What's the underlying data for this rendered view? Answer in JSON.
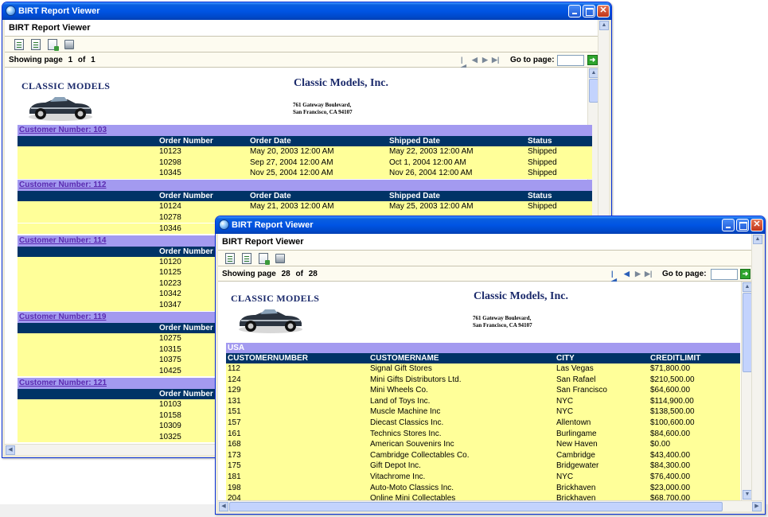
{
  "back_window": {
    "title": "BIRT Report Viewer",
    "header": "BIRT Report Viewer",
    "nav": {
      "showing": "Showing page",
      "page": "1",
      "of": "of",
      "total": "1",
      "goto_label": "Go to page:"
    },
    "company_name": "Classic Models, Inc.",
    "logo_text": "CLASSIC MODELS",
    "address_line1": "761 Gateway Boulevard,",
    "address_line2": "San Francisco, CA 94107",
    "columns": [
      "Order Number",
      "Order Date",
      "Shipped Date",
      "Status"
    ],
    "groups": [
      {
        "label": "Customer Number: 103",
        "rows": [
          [
            "10123",
            "May 20, 2003 12:00 AM",
            "May 22, 2003 12:00 AM",
            "Shipped"
          ],
          [
            "10298",
            "Sep 27, 2004 12:00 AM",
            "Oct 1, 2004 12:00 AM",
            "Shipped"
          ],
          [
            "10345",
            "Nov 25, 2004 12:00 AM",
            "Nov 26, 2004 12:00 AM",
            "Shipped"
          ]
        ]
      },
      {
        "label": "Customer Number: 112",
        "rows": [
          [
            "10124",
            "May 21, 2003 12:00 AM",
            "May 25, 2003 12:00 AM",
            "Shipped"
          ],
          [
            "10278",
            "",
            "",
            ""
          ],
          [
            "10346",
            "",
            "",
            ""
          ]
        ]
      },
      {
        "label": "Customer Number: 114",
        "rows": [
          [
            "10120",
            "",
            "",
            ""
          ],
          [
            "10125",
            "",
            "",
            ""
          ],
          [
            "10223",
            "",
            "",
            ""
          ],
          [
            "10342",
            "",
            "",
            ""
          ],
          [
            "10347",
            "",
            "",
            ""
          ]
        ]
      },
      {
        "label": "Customer Number: 119",
        "rows": [
          [
            "10275",
            "",
            "",
            ""
          ],
          [
            "10315",
            "",
            "",
            ""
          ],
          [
            "10375",
            "",
            "",
            ""
          ],
          [
            "10425",
            "",
            "",
            ""
          ]
        ]
      },
      {
        "label": "Customer Number: 121",
        "rows": [
          [
            "10103",
            "",
            "",
            ""
          ],
          [
            "10158",
            "",
            "",
            ""
          ],
          [
            "10309",
            "",
            "",
            ""
          ],
          [
            "10325",
            "",
            "",
            ""
          ]
        ]
      }
    ]
  },
  "front_window": {
    "title": "BIRT Report Viewer",
    "header": "BIRT Report Viewer",
    "nav": {
      "showing": "Showing page",
      "page": "28",
      "of": "of",
      "total": "28",
      "goto_label": "Go to page:"
    },
    "company_name": "Classic Models, Inc.",
    "logo_text": "CLASSIC MODELS",
    "address_line1": "761 Gateway Boulevard,",
    "address_line2": "San Francisco, CA 94107",
    "country": "USA",
    "columns": [
      "CUSTOMERNUMBER",
      "CUSTOMERNAME",
      "CITY",
      "CREDITLIMIT"
    ],
    "rows": [
      [
        "112",
        "Signal Gift Stores",
        "Las Vegas",
        "$71,800.00"
      ],
      [
        "124",
        "Mini Gifts Distributors Ltd.",
        "San Rafael",
        "$210,500.00"
      ],
      [
        "129",
        "Mini Wheels Co.",
        "San Francisco",
        "$64,600.00"
      ],
      [
        "131",
        "Land of Toys Inc.",
        "NYC",
        "$114,900.00"
      ],
      [
        "151",
        "Muscle Machine Inc",
        "NYC",
        "$138,500.00"
      ],
      [
        "157",
        "Diecast Classics Inc.",
        "Allentown",
        "$100,600.00"
      ],
      [
        "161",
        "Technics Stores Inc.",
        "Burlingame",
        "$84,600.00"
      ],
      [
        "168",
        "American Souvenirs Inc",
        "New Haven",
        "$0.00"
      ],
      [
        "173",
        "Cambridge Collectables Co.",
        "Cambridge",
        "$43,400.00"
      ],
      [
        "175",
        "Gift Depot Inc.",
        "Bridgewater",
        "$84,300.00"
      ],
      [
        "181",
        "Vitachrome Inc.",
        "NYC",
        "$76,400.00"
      ],
      [
        "198",
        "Auto-Moto Classics Inc.",
        "Brickhaven",
        "$23,000.00"
      ],
      [
        "204",
        "Online Mini Collectables",
        "Brickhaven",
        "$68,700.00"
      ]
    ]
  },
  "icons": [
    "toc-icon",
    "parameter-icon",
    "export-icon",
    "print-icon",
    "first-page-icon",
    "previous-page-icon",
    "next-page-icon",
    "last-page-icon",
    "go-arrow-icon",
    "minimize-icon",
    "maximize-icon",
    "close-icon"
  ]
}
